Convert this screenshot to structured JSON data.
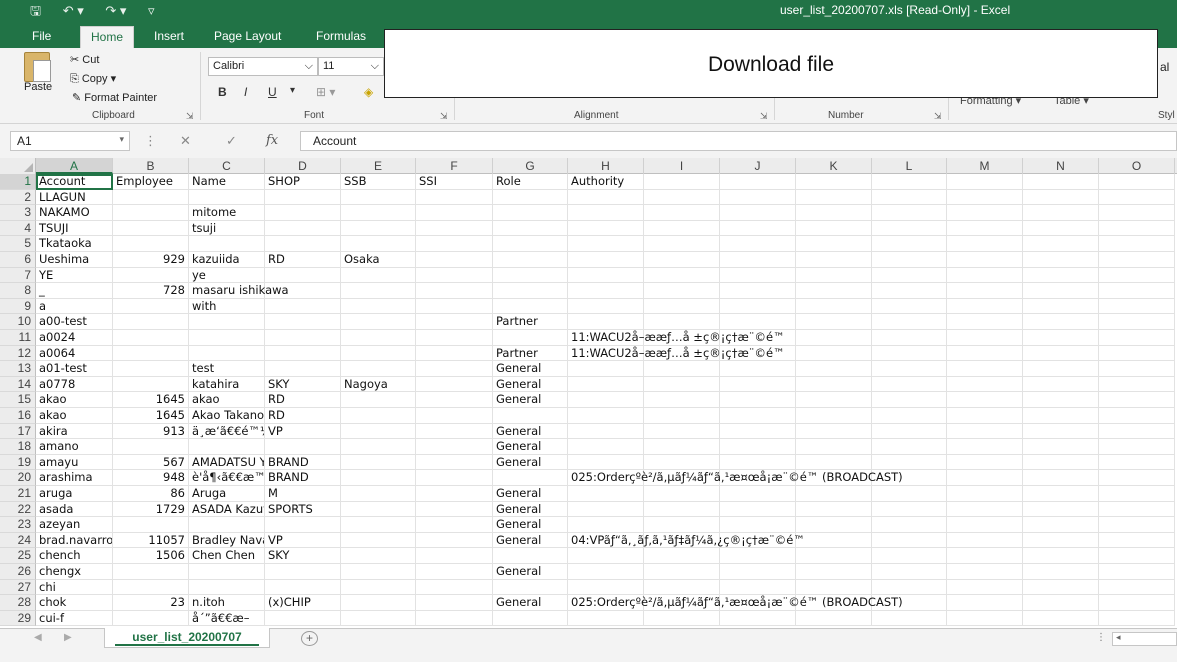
{
  "window": {
    "title": "user_list_20200707.xls  [Read-Only]  -  Excel",
    "quick_access": [
      "save-icon",
      "undo-icon",
      "redo-icon",
      "customize-icon"
    ]
  },
  "ribbon_tabs": [
    "File",
    "Home",
    "Insert",
    "Page Layout",
    "Formulas"
  ],
  "active_tab": "Home",
  "ribbon": {
    "clipboard": {
      "paste": "Paste",
      "cut": "Cut",
      "copy": "Copy",
      "format_painter": "Format Painter",
      "label": "Clipboard"
    },
    "font": {
      "name": "Calibri",
      "size": "11",
      "label": "Font",
      "bold": "B",
      "italic": "I",
      "underline": "U"
    },
    "alignment_label": "Alignment",
    "number_label": "Number",
    "styles_label": "Styl",
    "formatting_partial": "Formatting",
    "table_partial": "Table",
    "right_partial": "al"
  },
  "overlay_banner": "Download file",
  "formula_bar": {
    "cell_ref": "A1",
    "fx_label": "fx",
    "content": "Account"
  },
  "columns": [
    {
      "id": "A",
      "w": 77
    },
    {
      "id": "B",
      "w": 76
    },
    {
      "id": "C",
      "w": 76
    },
    {
      "id": "D",
      "w": 76
    },
    {
      "id": "E",
      "w": 75
    },
    {
      "id": "F",
      "w": 77
    },
    {
      "id": "G",
      "w": 75
    },
    {
      "id": "H",
      "w": 76
    },
    {
      "id": "I",
      "w": 76
    },
    {
      "id": "J",
      "w": 76
    },
    {
      "id": "K",
      "w": 76
    },
    {
      "id": "L",
      "w": 75
    },
    {
      "id": "M",
      "w": 76
    },
    {
      "id": "N",
      "w": 76
    },
    {
      "id": "O",
      "w": 76
    }
  ],
  "rows": [
    [
      "Account",
      "Employee",
      "Name",
      "SHOP",
      "SSB",
      "SSI",
      "Role",
      "Authority"
    ],
    [
      "LLAGUN",
      "",
      "",
      "",
      "",
      "",
      "",
      ""
    ],
    [
      "NAKAMO",
      "",
      "mitome",
      "",
      "",
      "",
      "",
      ""
    ],
    [
      "TSUJI",
      "",
      "tsuji",
      "",
      "",
      "",
      "",
      ""
    ],
    [
      "Tkataoka",
      "",
      "",
      "",
      "",
      "",
      "",
      ""
    ],
    [
      "Ueshima",
      "929",
      "kazuiida",
      "RD",
      "Osaka",
      "",
      "",
      ""
    ],
    [
      "YE",
      "",
      "ye",
      "",
      "",
      "",
      "",
      ""
    ],
    [
      "_",
      "728",
      "masaru ishikawa",
      "",
      "",
      "",
      "",
      ""
    ],
    [
      "a",
      "",
      "with",
      "",
      "",
      "",
      "",
      ""
    ],
    [
      "a00-test",
      "",
      "",
      "",
      "",
      "",
      "Partner",
      ""
    ],
    [
      "a0024",
      "",
      "",
      "",
      "",
      "",
      "",
      "11:WACU2å–ææƒ…å ±ç®¡ç†æ¨©é™"
    ],
    [
      "a0064",
      "",
      "",
      "",
      "",
      "",
      "Partner",
      "11:WACU2å–ææƒ…å ±ç®¡ç†æ¨©é™"
    ],
    [
      "a01-test",
      "",
      "test",
      "",
      "",
      "",
      "General",
      ""
    ],
    [
      "a0778",
      "",
      "katahira",
      "SKY",
      "Nagoya",
      "",
      "General",
      ""
    ],
    [
      "akao",
      "1645",
      "akao",
      "RD",
      "",
      "",
      "General",
      ""
    ],
    [
      "akao",
      "1645",
      "Akao Takanori",
      "RD",
      "",
      "",
      "",
      ""
    ],
    [
      "akira",
      "913",
      "ä¸­æ‘ã€€é™½",
      "VP",
      "",
      "",
      "General",
      ""
    ],
    [
      "amano",
      "",
      "",
      "",
      "",
      "",
      "General",
      ""
    ],
    [
      "amayu",
      "567",
      "AMADATSU Yuka",
      "BRAND",
      "",
      "",
      "General",
      ""
    ],
    [
      "arashima",
      "948",
      "è'å¶‹ã€€æ™",
      "BRAND",
      "",
      "",
      "",
      "025:Orderçºè²/ã,µãƒ¼ãƒ“ã,¹æ¤œå¡æ¨©é™ (BROADCAST)"
    ],
    [
      "aruga",
      "86",
      "Aruga",
      "M",
      "",
      "",
      "General",
      ""
    ],
    [
      "asada",
      "1729",
      "ASADA Kazuya",
      "SPORTS",
      "",
      "",
      "General",
      ""
    ],
    [
      "azeyan",
      "",
      "",
      "",
      "",
      "",
      "General",
      ""
    ],
    [
      "brad.navarro",
      "11057",
      "Bradley Navarro",
      "VP",
      "",
      "",
      "General",
      "04:VPãƒ“ã,¸ãƒ,ã,¹ãƒ‡ãƒ¼ã,¿ç®¡ç†æ¨©é™"
    ],
    [
      "chench",
      "1506",
      "Chen Chen",
      "SKY",
      "",
      "",
      "",
      ""
    ],
    [
      "chengx",
      "",
      "",
      "",
      "",
      "",
      "General",
      ""
    ],
    [
      "chi",
      "",
      "",
      "",
      "",
      "",
      "",
      ""
    ],
    [
      "chok",
      "23",
      "n.itoh",
      "(x)CHIP",
      "",
      "",
      "General",
      "025:Orderçºè²/ã,µãƒ¼ãƒ“ã,¹æ¤œå¡æ¨©é™ (BROADCAST)"
    ],
    [
      "cui-f",
      "",
      "å´”ã€€æ–",
      "",
      "",
      "",
      "",
      ""
    ]
  ],
  "sheet_tab": "user_list_20200707"
}
